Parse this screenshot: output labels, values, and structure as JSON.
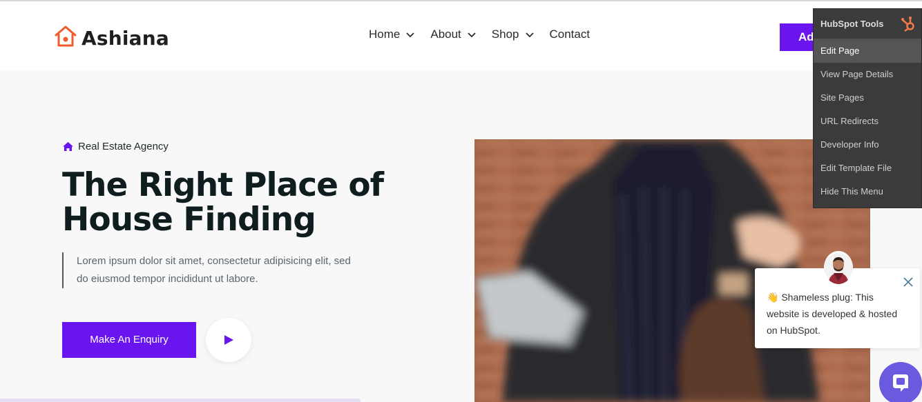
{
  "brand": {
    "name": "Ashiana",
    "accent": "#6a14f0",
    "logo_color": "#f15a2b"
  },
  "nav": {
    "items": [
      {
        "label": "Home",
        "has_dropdown": true
      },
      {
        "label": "About",
        "has_dropdown": true
      },
      {
        "label": "Shop",
        "has_dropdown": true
      },
      {
        "label": "Contact",
        "has_dropdown": false
      }
    ],
    "cta_label": "Ad"
  },
  "hero": {
    "tag": "Real Estate Agency",
    "title_line1": "The Right Place of",
    "title_line2": "House Finding",
    "desc_line1": "Lorem ipsum dolor sit amet, consectetur adipisicing elit, sed",
    "desc_line2": "do eiusmod tempor incididunt ut labore.",
    "button_label": "Make An Enquiry"
  },
  "hubspot_tools": {
    "title": "HubSpot Tools",
    "items": [
      {
        "label": "Edit Page",
        "active": true
      },
      {
        "label": "View Page Details"
      },
      {
        "label": "Site Pages"
      },
      {
        "label": "URL Redirects"
      },
      {
        "label": "Developer Info"
      },
      {
        "label": "Edit Template File"
      },
      {
        "label": "Hide This Menu"
      }
    ]
  },
  "chat": {
    "emoji": "👋",
    "line1": "Shameless plug: This",
    "line2": "website is developed & hosted",
    "line3": "on HubSpot."
  }
}
